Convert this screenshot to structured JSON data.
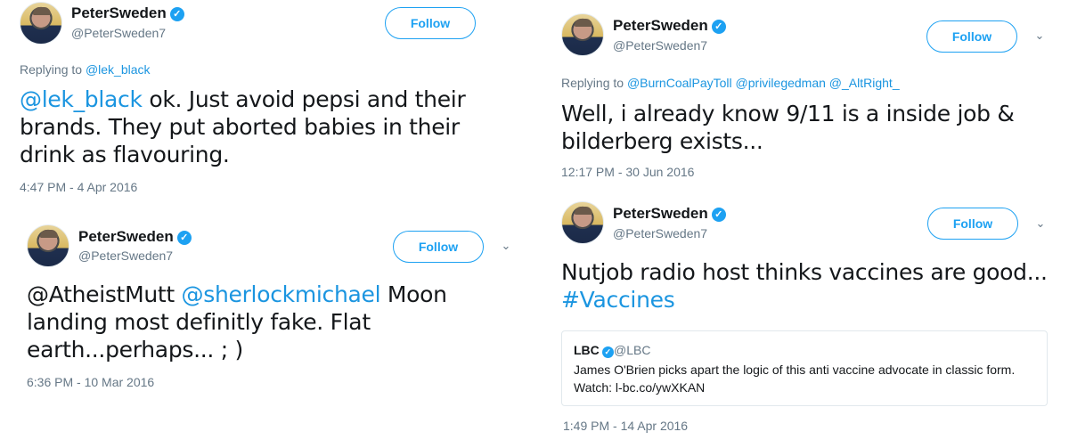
{
  "accent_color": "#1da1f2",
  "tweets": [
    {
      "author": "PeterSweden",
      "handle": "@PeterSweden7",
      "follow_label": "Follow",
      "replying_prefix": "Replying to",
      "replying_to": "@lek_black",
      "mention": "@lek_black",
      "text": " ok. Just avoid pepsi and their brands. They put aborted babies in their drink as flavouring.",
      "timestamp": "4:47 PM - 4 Apr 2016"
    },
    {
      "author": "PeterSweden",
      "handle": "@PeterSweden7",
      "follow_label": "Follow",
      "text_before": "@AtheistMutt ",
      "mention": "@sherlockmichael",
      "text": " Moon landing most definitly fake. Flat earth...perhaps... ; )",
      "timestamp": "6:36 PM - 10 Mar 2016"
    },
    {
      "author": "PeterSweden",
      "handle": "@PeterSweden7",
      "follow_label": "Follow",
      "replying_prefix": "Replying to",
      "replying_to": "@BurnCoalPayToll @privilegedman @_AltRight_",
      "text": "Well, i already know 9/11 is a inside job & bilderberg exists...",
      "timestamp": "12:17 PM - 30 Jun 2016"
    },
    {
      "author": "PeterSweden",
      "handle": "@PeterSweden7",
      "follow_label": "Follow",
      "text": "Nutjob radio host thinks vaccines are good...",
      "hashtag": "#Vaccines",
      "quote": {
        "name": "LBC",
        "handle": "@LBC",
        "text": "James O'Brien picks apart the logic of this anti vaccine advocate in classic form. Watch: l-bc.co/ywXKAN"
      },
      "timestamp": "1:49 PM - 14 Apr 2016"
    }
  ]
}
